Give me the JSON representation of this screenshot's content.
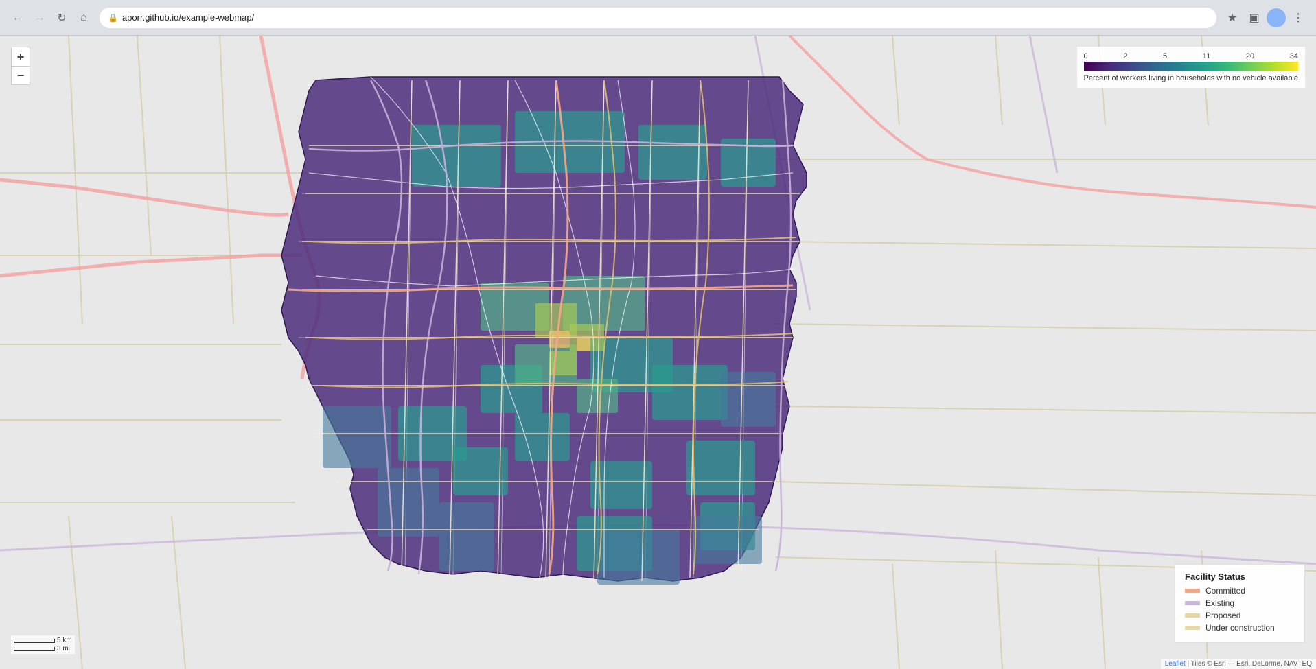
{
  "browser": {
    "url": "aporr.github.io/example-webmap/",
    "back_disabled": false,
    "forward_disabled": false
  },
  "legend": {
    "color_scale": {
      "title": "Percent of workers living in households with no vehicle available",
      "labels": [
        "0",
        "2",
        "5",
        "11",
        "20",
        "34"
      ],
      "colors": [
        "#440154",
        "#414487",
        "#2a788e",
        "#22a884",
        "#7ad151",
        "#fde725"
      ]
    },
    "facility_status": {
      "title": "Facility Status",
      "items": [
        {
          "label": "Committed",
          "color": "#f4a98a"
        },
        {
          "label": "Existing",
          "color": "#c9b8d9"
        },
        {
          "label": "Proposed",
          "color": "#e8d5a3"
        },
        {
          "label": "Under construction",
          "color": "#e8d5a3"
        }
      ]
    }
  },
  "attribution": {
    "leaflet_text": "Leaflet",
    "tiles_text": "| Tiles © Esri — Esri, DeLorme, NAVTEQ"
  },
  "scale": {
    "km": "5 km",
    "mi": "3 mi"
  },
  "zoom": {
    "plus": "+",
    "minus": "−"
  }
}
